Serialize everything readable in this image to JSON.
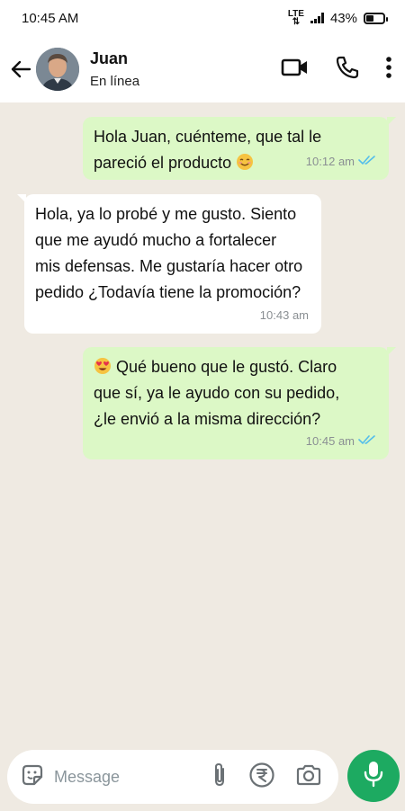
{
  "status_bar": {
    "time": "10:45 AM",
    "network": "LTE",
    "battery": "43%"
  },
  "header": {
    "contact_name": "Juan",
    "contact_status": "En línea"
  },
  "messages": [
    {
      "direction": "out",
      "text_line1": "Hola Juan, cuénteme, que tal le",
      "text_line2": "pareció el producto",
      "emoji": "smiling-face-icon",
      "time": "10:12 am",
      "read": true
    },
    {
      "direction": "in",
      "text_line1": "Hola, ya lo probé y me gusto. Siento",
      "text_line2": "que me ayudó mucho a fortalecer",
      "text_line3": "mis defensas. Me gustaría hacer otro",
      "text_line4": "pedido ¿Todavía tiene la promoción?",
      "time": "10:43 am"
    },
    {
      "direction": "out",
      "emoji": "heart-eyes-icon",
      "text_line1": "Qué bueno que le gustó. Claro",
      "text_line2": "que sí, ya le ayudo con su pedido,",
      "text_line3": "¿le envió a la misma dirección?",
      "time": "10:45 am",
      "read": true
    }
  ],
  "composer": {
    "placeholder": "Message"
  },
  "colors": {
    "outgoing_bubble": "#dcf8c6",
    "incoming_bubble": "#ffffff",
    "chat_background": "#efeae2",
    "mic_button": "#1daa61",
    "read_ticks": "#53bdeb"
  }
}
